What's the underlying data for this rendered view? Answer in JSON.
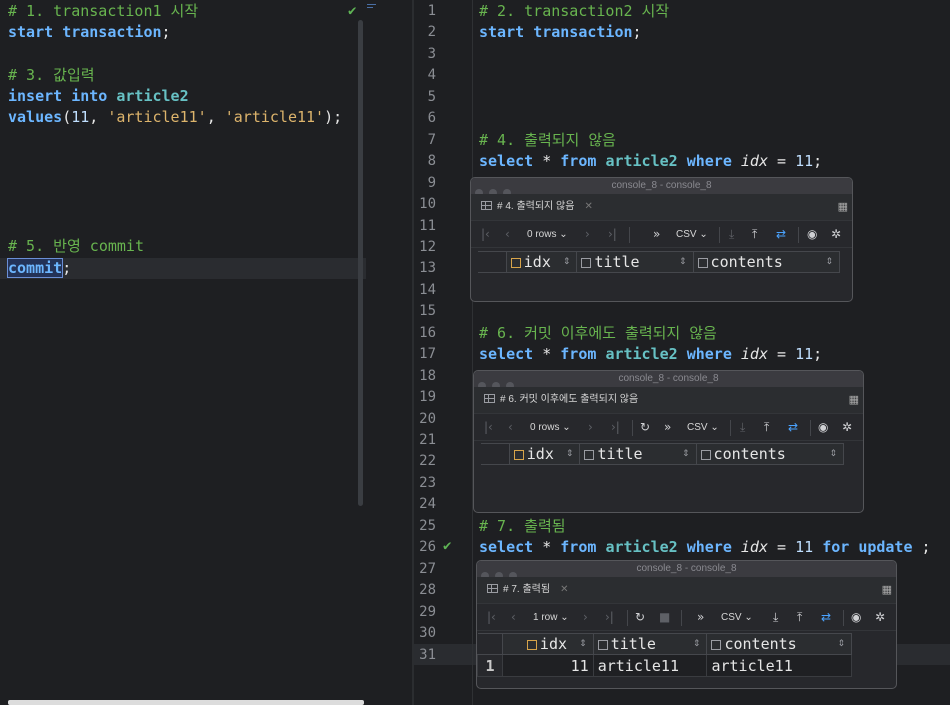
{
  "left_editor": {
    "lines": [
      {
        "segments": [
          {
            "t": "# 1. transaction1 시작",
            "c": "cm"
          }
        ]
      },
      {
        "segments": [
          {
            "t": "start ",
            "c": "kw"
          },
          {
            "t": "transaction",
            "c": "kw"
          },
          {
            "t": ";",
            "c": "plain"
          }
        ]
      },
      {
        "segments": []
      },
      {
        "segments": [
          {
            "t": "# 3. 값입력",
            "c": "cm"
          }
        ]
      },
      {
        "segments": [
          {
            "t": "insert ",
            "c": "kw"
          },
          {
            "t": "into ",
            "c": "kw"
          },
          {
            "t": "article2",
            "c": "ident"
          }
        ]
      },
      {
        "segments": [
          {
            "t": "values",
            "c": "kw"
          },
          {
            "t": "(",
            "c": "plain"
          },
          {
            "t": "11",
            "c": "num"
          },
          {
            "t": ", ",
            "c": "plain"
          },
          {
            "t": "'article11'",
            "c": "str"
          },
          {
            "t": ", ",
            "c": "plain"
          },
          {
            "t": "'article11'",
            "c": "str"
          },
          {
            "t": ");",
            "c": "plain"
          }
        ]
      },
      {
        "segments": []
      },
      {
        "segments": []
      },
      {
        "segments": []
      },
      {
        "segments": []
      },
      {
        "segments": []
      },
      {
        "segments": [
          {
            "t": "# 5. 반영 commit",
            "c": "cm"
          }
        ]
      },
      {
        "segments": [
          {
            "t": "commit",
            "c": "kw sel-box"
          },
          {
            "t": ";",
            "c": "plain"
          }
        ]
      }
    ]
  },
  "right_editor": {
    "line_numbers": [
      "1",
      "2",
      "3",
      "4",
      "5",
      "6",
      "7",
      "8",
      "9",
      "10",
      "11",
      "12",
      "13",
      "14",
      "15",
      "16",
      "17",
      "18",
      "19",
      "20",
      "21",
      "22",
      "23",
      "24",
      "25",
      "26",
      "27",
      "28",
      "29",
      "30",
      "31"
    ],
    "lines": [
      {
        "n": 1,
        "segments": [
          {
            "t": "# 2. transaction2 시작",
            "c": "cm"
          }
        ]
      },
      {
        "n": 2,
        "segments": [
          {
            "t": "start ",
            "c": "kw"
          },
          {
            "t": "transaction",
            "c": "kw"
          },
          {
            "t": ";",
            "c": "plain"
          }
        ]
      },
      {
        "n": 7,
        "segments": [
          {
            "t": "# 4. 출력되지 않음",
            "c": "cm"
          }
        ]
      },
      {
        "n": 8,
        "segments": [
          {
            "t": "select ",
            "c": "kw"
          },
          {
            "t": "* ",
            "c": "plain"
          },
          {
            "t": "from ",
            "c": "kw"
          },
          {
            "t": "article2 ",
            "c": "ident"
          },
          {
            "t": "where ",
            "c": "kw"
          },
          {
            "t": "idx",
            "c": "ital"
          },
          {
            "t": " = ",
            "c": "plain"
          },
          {
            "t": "11",
            "c": "num"
          },
          {
            "t": ";",
            "c": "plain"
          }
        ]
      },
      {
        "n": 16,
        "segments": [
          {
            "t": "# 6. 커밋 이후에도 출력되지 않음",
            "c": "cm"
          }
        ]
      },
      {
        "n": 17,
        "segments": [
          {
            "t": "select ",
            "c": "kw"
          },
          {
            "t": "* ",
            "c": "plain"
          },
          {
            "t": "from ",
            "c": "kw"
          },
          {
            "t": "article2 ",
            "c": "ident"
          },
          {
            "t": "where ",
            "c": "kw"
          },
          {
            "t": "idx",
            "c": "ital"
          },
          {
            "t": " = ",
            "c": "plain"
          },
          {
            "t": "11",
            "c": "num"
          },
          {
            "t": ";",
            "c": "plain"
          }
        ]
      },
      {
        "n": 25,
        "segments": [
          {
            "t": "# 7. 출력됨",
            "c": "cm"
          }
        ]
      },
      {
        "n": 26,
        "segments": [
          {
            "t": "select ",
            "c": "kw"
          },
          {
            "t": "* ",
            "c": "plain"
          },
          {
            "t": "from ",
            "c": "kw"
          },
          {
            "t": "article2 ",
            "c": "ident"
          },
          {
            "t": "where ",
            "c": "kw"
          },
          {
            "t": "idx",
            "c": "ital"
          },
          {
            "t": " = ",
            "c": "plain"
          },
          {
            "t": "11 ",
            "c": "num"
          },
          {
            "t": "for ",
            "c": "kw"
          },
          {
            "t": "update ",
            "c": "kw"
          },
          {
            "t": ";",
            "c": "plain"
          }
        ]
      }
    ]
  },
  "consoles": [
    {
      "window_title": "console_8 - console_8",
      "tab_label": "# 4. 출력되지 않음",
      "rows_label": "0 rows",
      "export_label": "CSV",
      "columns": [
        "idx",
        "title",
        "contents"
      ],
      "rows": []
    },
    {
      "window_title": "console_8 - console_8",
      "tab_label": "# 6. 커밋 이후에도 출력되지 않음",
      "rows_label": "0 rows",
      "export_label": "CSV",
      "columns": [
        "idx",
        "title",
        "contents"
      ],
      "rows": []
    },
    {
      "window_title": "console_8 - console_8",
      "tab_label": "# 7. 출력됨",
      "rows_label": "1 row",
      "export_label": "CSV",
      "columns": [
        "idx",
        "title",
        "contents"
      ],
      "rows": [
        {
          "num": "1",
          "cells": [
            "11",
            "article11",
            "article11"
          ]
        }
      ]
    }
  ],
  "icons": {
    "check": "check-icon",
    "first_page": "first-page-icon",
    "prev_page": "prev-page-icon",
    "next_page": "next-page-icon",
    "last_page": "last-page-icon",
    "reload": "reload-icon",
    "stop": "stop-icon",
    "download": "download-icon",
    "upload": "upload-icon",
    "compare": "compare-icon",
    "view": "eye-icon",
    "settings": "gear-icon"
  },
  "colors": {
    "keyword": "#6cb6ff",
    "identifier": "#67c1c4",
    "comment": "#68b44f",
    "string": "#ddb46c",
    "background": "#1e1f22"
  }
}
